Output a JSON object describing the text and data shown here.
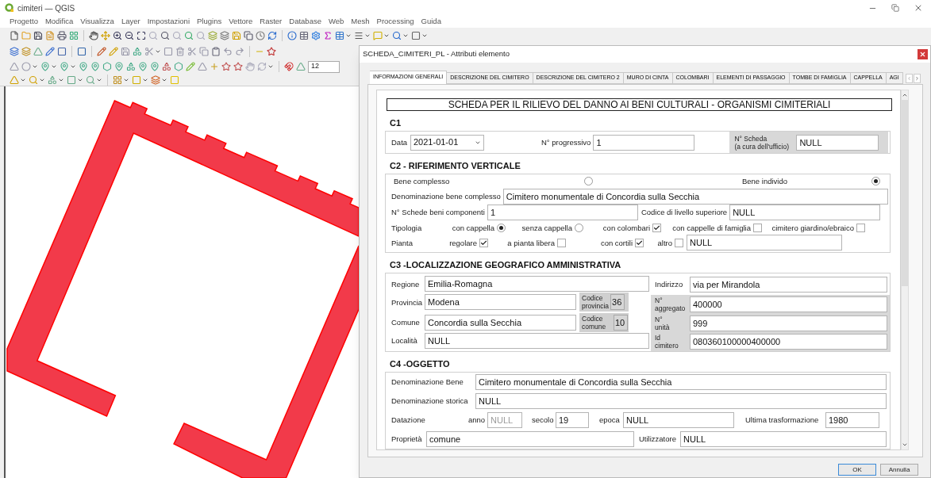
{
  "app": {
    "title": "cimiteri — QGIS"
  },
  "menu": [
    "Progetto",
    "Modifica",
    "Visualizza",
    "Layer",
    "Impostazioni",
    "Plugins",
    "Vettore",
    "Raster",
    "Database",
    "Web",
    "Mesh",
    "Processing",
    "Guida"
  ],
  "toolbar": {
    "spin_value": "12"
  },
  "dialog": {
    "title": "SCHEDA_CIMITERI_PL - Attributi elemento",
    "tabs": [
      {
        "label": "INFORMAZIONI GENERALI",
        "selected": true
      },
      {
        "label": "DESCRIZIONE DEL CIMITERO",
        "selected": false
      },
      {
        "label": "DESCRIZIONE DEL CIMITERO 2",
        "selected": false
      },
      {
        "label": "MURO DI CINTA",
        "selected": false
      },
      {
        "label": "COLOMBARI",
        "selected": false
      },
      {
        "label": "ELEMENTI DI PASSAGGIO",
        "selected": false
      },
      {
        "label": "TOMBE DI FAMIGLIA",
        "selected": false
      },
      {
        "label": "CAPPELLA",
        "selected": false
      },
      {
        "label": "AGI",
        "selected": false
      }
    ],
    "heading": "SCHEDA PER IL RILIEVO DEL DANNO AI BENI CULTURALI - ORGANISMI CIMITERIALI",
    "c1": {
      "title": "C1",
      "data": {
        "label": "Data",
        "value": "2021-01-01"
      },
      "progressivo": {
        "label": "N° progressivo",
        "value": "1"
      },
      "scheda": {
        "label": "N° Scheda\n(a cura dell'ufficio)",
        "value": "NULL"
      }
    },
    "c2": {
      "title": "C2 - RIFERIMENTO VERTICALE",
      "choice": [
        {
          "label": "Bene complesso",
          "selected": false
        },
        {
          "label": "Bene individo",
          "selected": true
        }
      ],
      "denominazione": {
        "label": "Denominazione bene complesso",
        "value": "Cimitero monumentale di Concordia sulla Secchia"
      },
      "schede": {
        "label": "N° Schede beni componenti",
        "value": "1"
      },
      "codice": {
        "label": "Codice di livello superiore",
        "value": "NULL"
      },
      "tipologia": {
        "label": "Tipologia",
        "options": [
          {
            "label": "con cappella",
            "kind": "radio",
            "checked": true
          },
          {
            "label": "senza cappella",
            "kind": "radio",
            "checked": false
          },
          {
            "label": "con colombari",
            "kind": "checkbox",
            "checked": true
          },
          {
            "label": "con cappelle di famiglia",
            "kind": "checkbox",
            "checked": false
          },
          {
            "label": "cimitero giardino/ebraico",
            "kind": "checkbox",
            "checked": false
          }
        ]
      },
      "pianta": {
        "label": "Pianta",
        "options": [
          {
            "label": "regolare",
            "kind": "checkbox",
            "checked": true
          },
          {
            "label": "a pianta libera",
            "kind": "checkbox",
            "checked": false
          },
          {
            "label": "con cortili",
            "kind": "checkbox",
            "checked": true
          },
          {
            "label": "altro",
            "kind": "checkbox",
            "checked": false
          }
        ],
        "altro_value": "NULL"
      }
    },
    "c3": {
      "title": "C3 -LOCALIZZAZIONE GEOGRAFICO AMMINISTRATIVA",
      "regione": {
        "label": "Regione",
        "value": "Emilia-Romagna"
      },
      "indirizzo": {
        "label": "Indirizzo",
        "value": "via per Mirandola"
      },
      "provincia": {
        "label": "Provincia",
        "value": "Modena"
      },
      "codice_provincia": {
        "label": "Codice\nprovincia",
        "value": "36"
      },
      "aggregato": {
        "label": "N°\naggregato",
        "value": "400000"
      },
      "comune": {
        "label": "Comune",
        "value": "Concordia sulla Secchia"
      },
      "codice_comune": {
        "label": "Codice\ncomune",
        "value": "10"
      },
      "unita": {
        "label": "N°\nunità",
        "value": "999"
      },
      "localita": {
        "label": "Località",
        "value": "NULL"
      },
      "id_cimitero": {
        "label": "Id\ncimitero",
        "value": "080360100000400000"
      }
    },
    "c4": {
      "title": "C4 -OGGETTO",
      "denominazione_bene": {
        "label": "Denominazione Bene",
        "value": "Cimitero monumentale di Concordia sulla Secchia"
      },
      "denominazione_storica": {
        "label": "Denominazione storica",
        "value": "NULL"
      },
      "datazione": "Datazione",
      "anno": {
        "label": "anno",
        "value": "NULL",
        "disabled": true
      },
      "secolo": {
        "label": "secolo",
        "value": "19"
      },
      "epoca": {
        "label": "epoca",
        "value": "NULL"
      },
      "ultima": {
        "label": "Ultima trasformazione",
        "value": "1980"
      },
      "proprieta": {
        "label": "Proprietà",
        "value": "comune"
      },
      "utilizzatore": {
        "label": "Utilizzatore",
        "value": "NULL"
      }
    },
    "buttons": [
      "OK",
      "Annulla"
    ]
  }
}
